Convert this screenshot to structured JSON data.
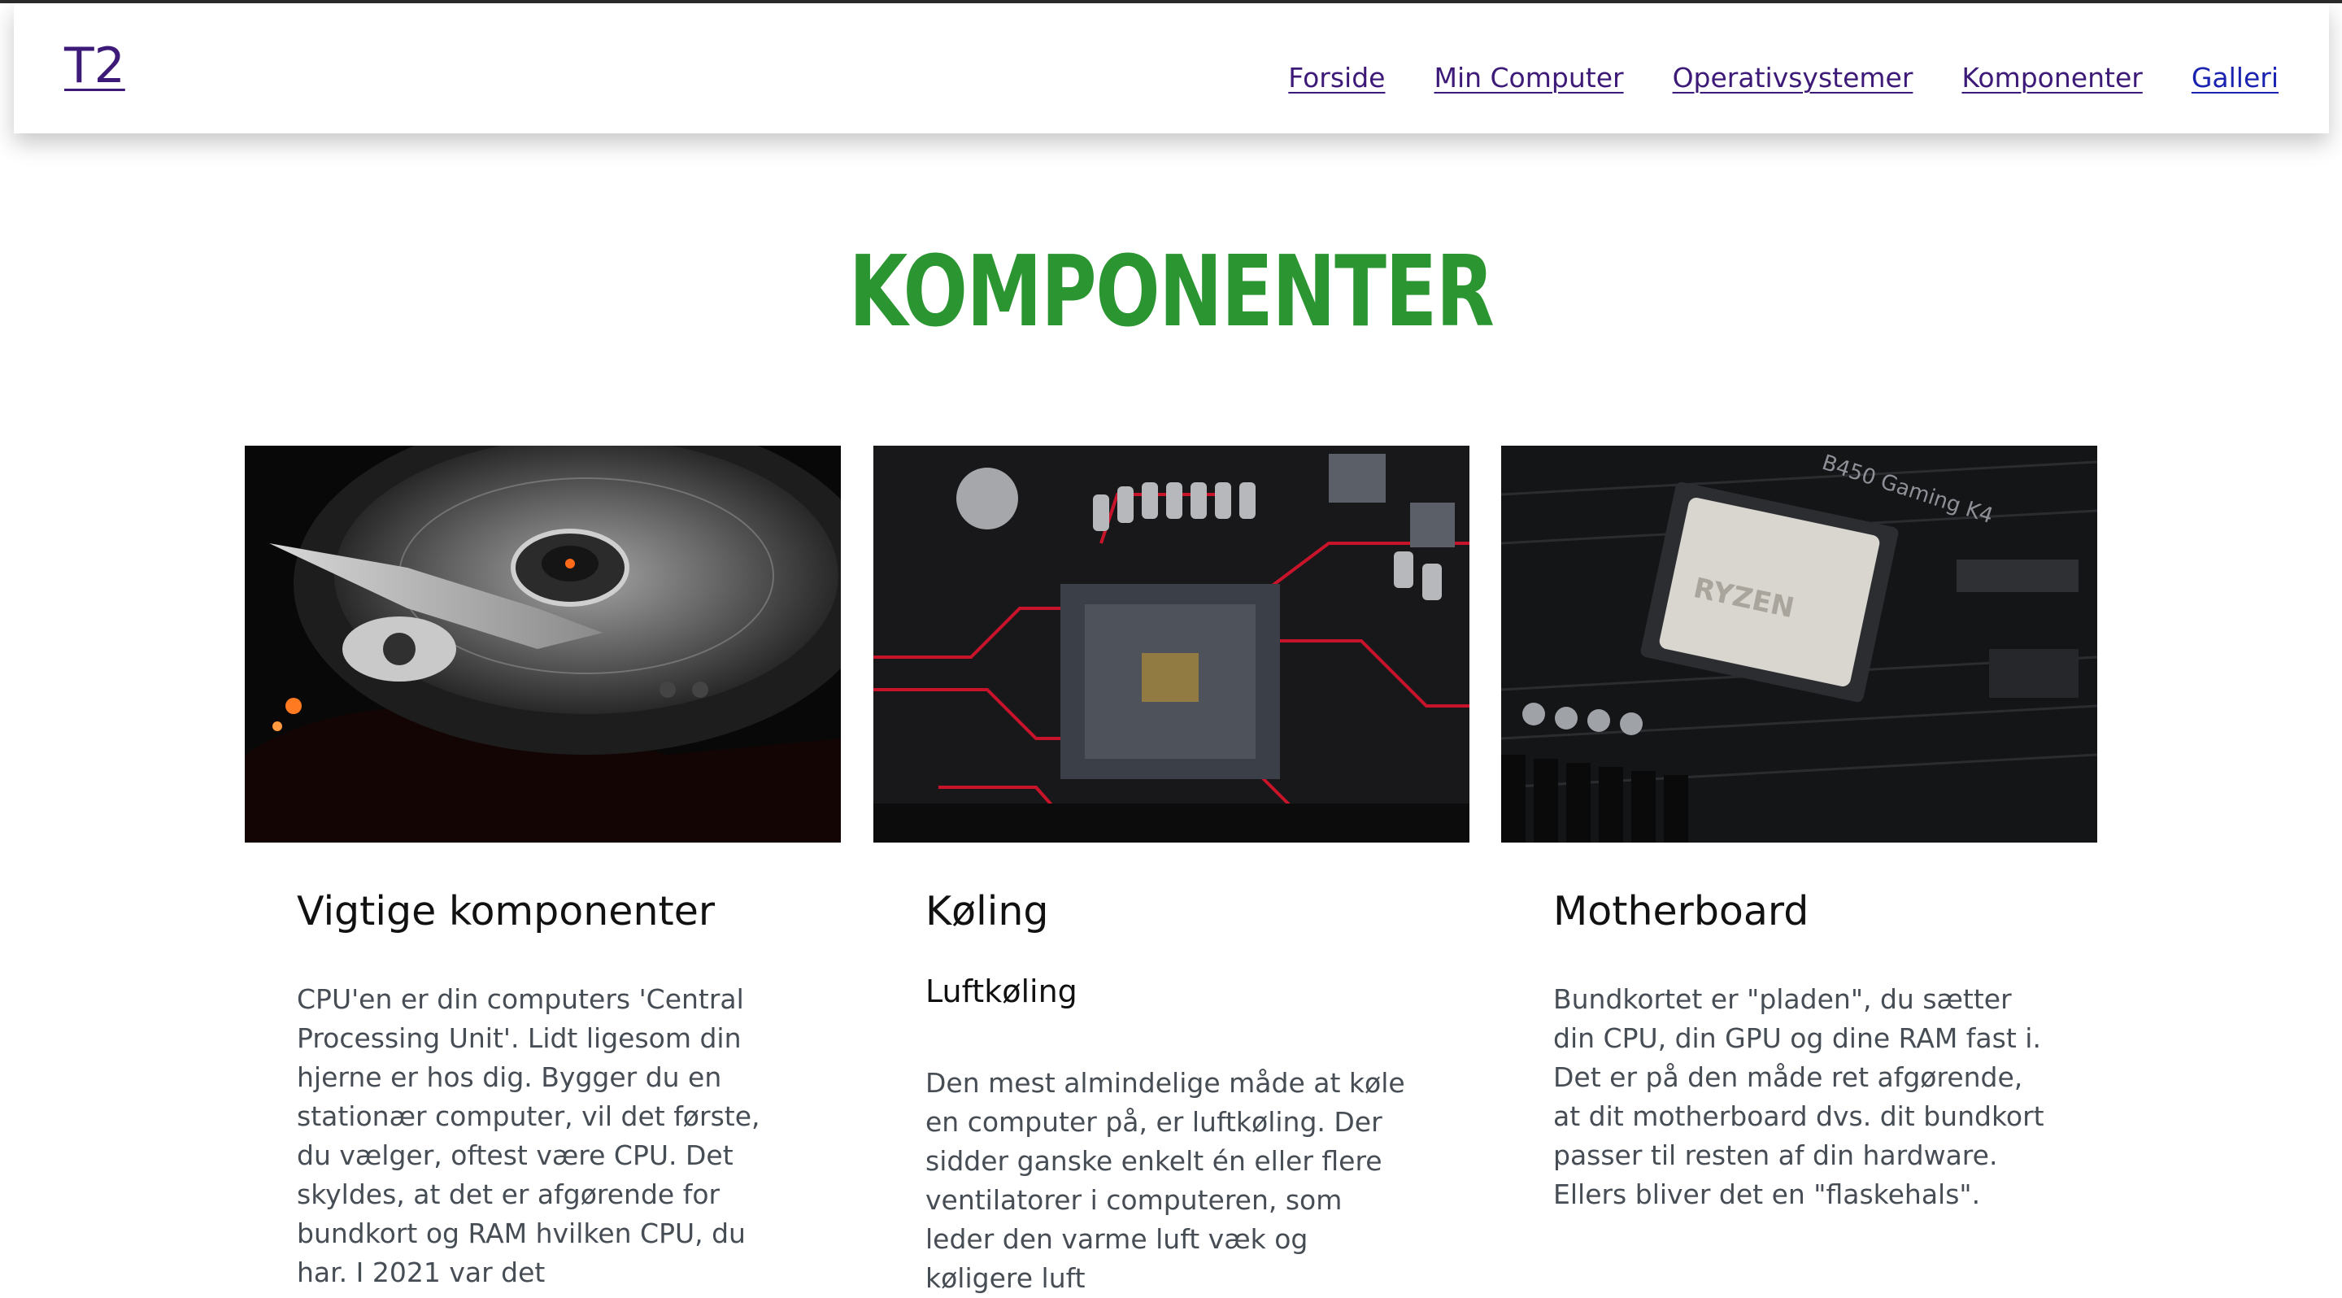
{
  "header": {
    "brand": "T2",
    "nav": [
      "Forside",
      "Min Computer",
      "Operativsystemer",
      "Komponenter",
      "Galleri"
    ]
  },
  "page": {
    "title": "KOMPONENTER"
  },
  "cards": [
    {
      "title": "Vigtige komponenter",
      "subtitle": "",
      "text": "CPU'en er din computers 'Central Processing Unit'. Lidt ligesom din hjerne er hos dig. Bygger du en stationær computer, vil det første, du vælger, oftest være CPU. Det skyldes, at det er afgørende for bundkort og RAM hvilken CPU, du har. I 2021 var det",
      "image": "hard-disk-drive"
    },
    {
      "title": "Køling",
      "subtitle": "Luftkøling",
      "text": "Den mest almindelige måde at køle en computer på, er luftkøling. Der sidder ganske enkelt én eller flere ventilatorer i computeren, som leder den varme luft væk og køligere luft",
      "image": "motherboard-cpu-socket"
    },
    {
      "title": "Motherboard",
      "subtitle": "",
      "text": "Bundkortet er \"pladen\", du sætter din CPU, din GPU og dine RAM fast i. Det er på den måde ret afgørende, at dit motherboard dvs. dit bundkort passer til resten af din hardware. Ellers bliver det en \"flaskehals\".",
      "image": "motherboard-ryzen"
    }
  ],
  "colors": {
    "title_green": "#2a9531",
    "link_purple": "#3d1a78",
    "link_blue": "#1a22b0",
    "body_text": "#474d54"
  },
  "image_text": {
    "chip_brand": "RYZEN",
    "board_label": "B450 Gaming K4"
  }
}
